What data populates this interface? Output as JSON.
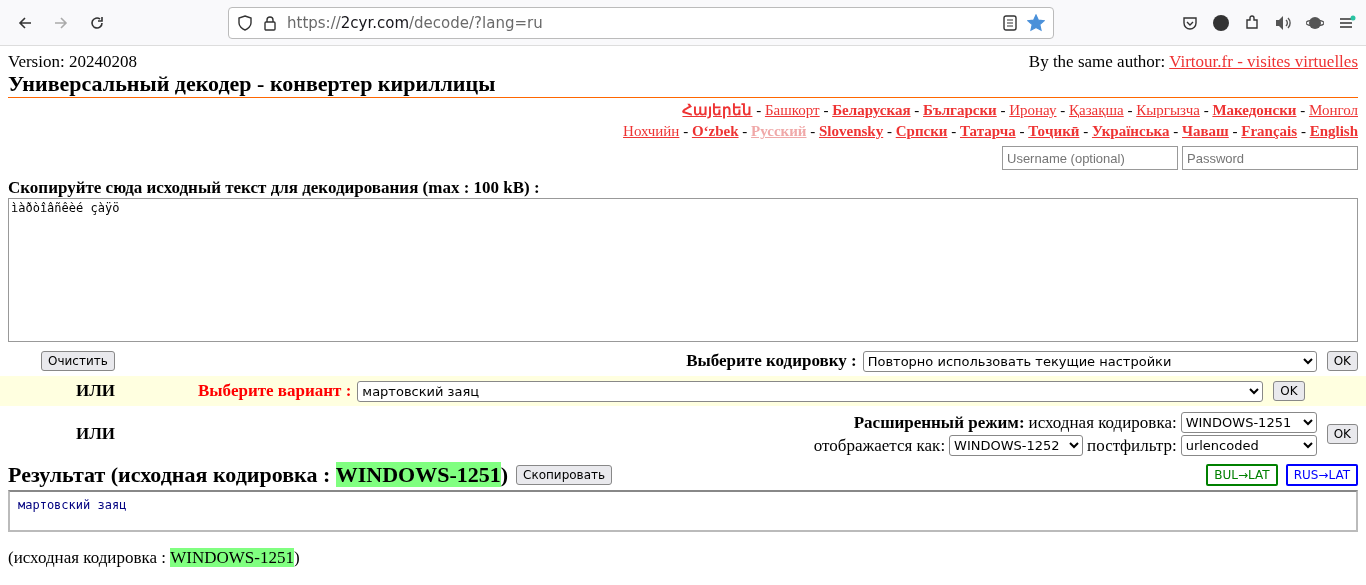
{
  "browser": {
    "url_scheme": "https://",
    "url_host": "2cyr.com",
    "url_path": "/decode/?lang=ru",
    "bookmarked": true
  },
  "header": {
    "version": "Version: 20240208",
    "author_label": "By the same author:",
    "author_link": "Virtour.fr - visites virtuelles",
    "title": "Универсальный декодер - конвертер кириллицы"
  },
  "language_rows": [
    [
      {
        "label": "Հայերեն",
        "bold": true,
        "selected": false,
        "sep": "-"
      },
      {
        "label": "Башкорт",
        "bold": false,
        "selected": false,
        "sep": "-"
      },
      {
        "label": "Беларуская",
        "bold": true,
        "selected": false,
        "sep": "-"
      },
      {
        "label": "Български",
        "bold": true,
        "selected": false,
        "sep": "-"
      },
      {
        "label": "Иронау",
        "bold": false,
        "selected": false,
        "sep": "-"
      },
      {
        "label": "Қазақша",
        "bold": false,
        "selected": false,
        "sep": "-"
      },
      {
        "label": "Кыргызча",
        "bold": false,
        "selected": false,
        "sep": "-"
      },
      {
        "label": "Македонски",
        "bold": true,
        "selected": false,
        "sep": "-"
      },
      {
        "label": "Монгол",
        "bold": false,
        "selected": false
      }
    ],
    [
      {
        "label": "Нохчийн",
        "bold": false,
        "selected": false,
        "sep": "-"
      },
      {
        "label": "O‘zbek",
        "bold": true,
        "selected": false,
        "sep": "-"
      },
      {
        "label": "Русский",
        "bold": true,
        "selected": true,
        "sep": "-"
      },
      {
        "label": "Slovensky",
        "bold": true,
        "selected": false,
        "sep": "-"
      },
      {
        "label": "Српски",
        "bold": true,
        "selected": false,
        "sep": "-"
      },
      {
        "label": "Татарча",
        "bold": true,
        "selected": false,
        "sep": "-"
      },
      {
        "label": "Тоҷикӣ",
        "bold": true,
        "selected": false,
        "sep": "-"
      },
      {
        "label": "Українська",
        "bold": true,
        "selected": false,
        "sep": "-"
      },
      {
        "label": "Чаваш",
        "bold": true,
        "selected": false,
        "sep": "-"
      },
      {
        "label": "Français",
        "bold": true,
        "selected": false,
        "sep": "-"
      },
      {
        "label": "English",
        "bold": true,
        "selected": false
      }
    ]
  ],
  "login": {
    "username_placeholder": "Username (optional)",
    "password_placeholder": "Password"
  },
  "source": {
    "label": "Скопируйте сюда исходный текст для декодирования (max : 100 kB) :",
    "value": "ìàðòîâñêèé çàÿö",
    "clear_button": "Очистить"
  },
  "encoding": {
    "label": "Выберите кодировку :",
    "value": "Повторно использовать текущие настройки",
    "ok": "OK"
  },
  "variant": {
    "or": "ИЛИ",
    "label": "Выберите вариант :",
    "value": "мартовский заяц",
    "ok": "OK"
  },
  "advanced": {
    "or": "ИЛИ",
    "label": "Расширенный режим:",
    "source_label": "исходная кодировка:",
    "source_value": "WINDOWS-1251",
    "display_label": "отображается как:",
    "display_value": "WINDOWS-1252",
    "postfilter_label": "постфильтр:",
    "postfilter_value": "urlencoded",
    "ok": "OK"
  },
  "result": {
    "title_prefix": "Результат (исходная кодировка :",
    "encoding": "WINDOWS-1251",
    "title_suffix": ")",
    "copy_button": "Скопировать",
    "translit": [
      {
        "label": "BUL→LAT",
        "color": "#008000"
      },
      {
        "label": "RUS→LAT",
        "color": "#0000ff"
      }
    ],
    "text": "мартовский заяц"
  },
  "footer": {
    "prefix": "(исходная кодировка :",
    "encoding": "WINDOWS-1251",
    "suffix": ")"
  }
}
